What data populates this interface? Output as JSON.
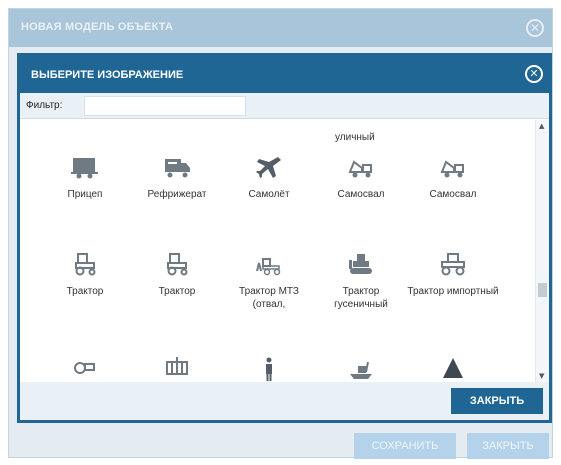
{
  "outer_dialog": {
    "title": "НОВАЯ МОДЕЛЬ ОБЪЕКТА",
    "save_label": "СОХРАНИТЬ",
    "close_label": "ЗАКРЫТЬ"
  },
  "modal": {
    "title": "ВЫБЕРИТЕ ИЗОБРАЖЕНИЕ",
    "filter_label": "Фильтр:",
    "filter_value": "",
    "close_button": "ЗАКРЫТЬ",
    "partial_top_label": "уличный",
    "items": [
      {
        "label": "Прицеп",
        "icon": "trailer-icon"
      },
      {
        "label": "Рефрижерат",
        "icon": "refrigerator-truck-icon"
      },
      {
        "label": "Самолёт",
        "icon": "airplane-icon"
      },
      {
        "label": "Самосвал",
        "icon": "dump-truck-icon"
      },
      {
        "label": "Самосвал",
        "icon": "dump-truck-icon"
      },
      {
        "label": "Трактор",
        "icon": "tractor-icon"
      },
      {
        "label": "Трактор",
        "icon": "tractor-icon"
      },
      {
        "label": "Трактор МТЗ (отвал,",
        "icon": "tractor-blade-icon"
      },
      {
        "label": "Трактор гусеничный",
        "icon": "crawler-tractor-icon"
      },
      {
        "label": "Трактор импортный",
        "icon": "imported-tractor-icon"
      },
      {
        "label": "",
        "icon": "tractor-icon"
      },
      {
        "label": "",
        "icon": "tram-icon"
      },
      {
        "label": "",
        "icon": "pedestrian-icon"
      },
      {
        "label": "",
        "icon": "boat-icon"
      },
      {
        "label": "",
        "icon": "warning-cone-icon"
      }
    ]
  },
  "colors": {
    "accent": "#1f6695",
    "icon": "#6f7a83"
  }
}
